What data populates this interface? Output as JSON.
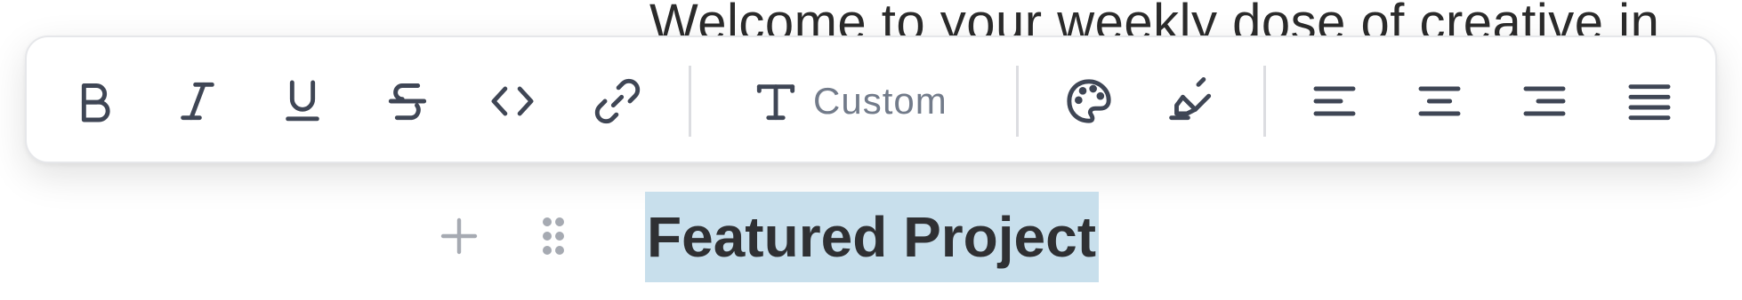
{
  "editor": {
    "paragraph_text": "Welcome to your weekly dose of creative in",
    "heading_text": "Featured Project"
  },
  "toolbar": {
    "buttons": [
      {
        "name": "bold",
        "icon": "bold-icon"
      },
      {
        "name": "italic",
        "icon": "italic-icon"
      },
      {
        "name": "underline",
        "icon": "underline-icon"
      },
      {
        "name": "strikethrough",
        "icon": "strikethrough-icon"
      },
      {
        "name": "code",
        "icon": "code-icon"
      },
      {
        "name": "link",
        "icon": "link-icon"
      },
      {
        "name": "font-style",
        "icon": "text-type-icon"
      },
      {
        "name": "text-color",
        "icon": "palette-icon"
      },
      {
        "name": "highlight",
        "icon": "highlighter-icon"
      },
      {
        "name": "align-left",
        "icon": "align-left-icon"
      },
      {
        "name": "align-center",
        "icon": "align-center-icon"
      },
      {
        "name": "align-right",
        "icon": "align-right-icon"
      },
      {
        "name": "justify",
        "icon": "align-justify-icon"
      }
    ],
    "font_label": "Custom"
  },
  "block_controls": {
    "add_icon": "plus-icon",
    "drag_icon": "drag-handle-icon"
  },
  "colors": {
    "selection_highlight": "#c8dfec",
    "icon_stroke": "#3f4655",
    "muted_icon": "#a6aab2"
  }
}
